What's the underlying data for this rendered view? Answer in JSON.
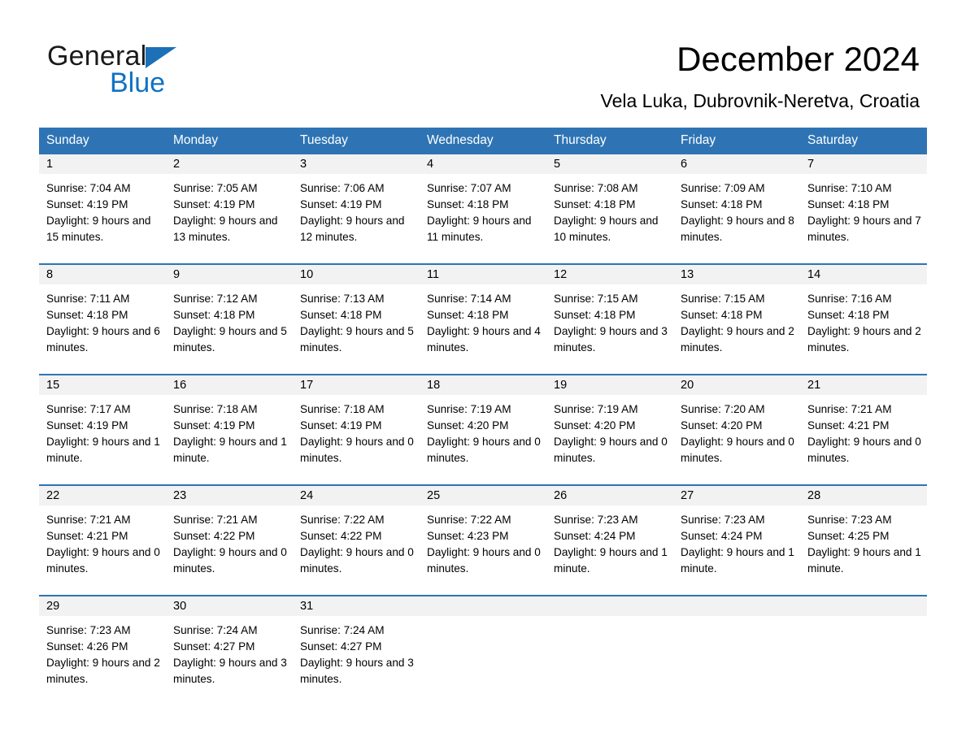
{
  "brand": {
    "name_part1": "General",
    "name_part2": "Blue",
    "triangle_color": "#1b70b8",
    "blue_text_color": "#0f72c4"
  },
  "header": {
    "title": "December 2024",
    "subtitle": "Vela Luka, Dubrovnik-Neretva, Croatia"
  },
  "theme": {
    "header_blue": "#2e74b5",
    "daystrip_gray": "#f2f2f2",
    "text_black": "#000000",
    "header_text_white": "#ffffff"
  },
  "weekdays": [
    "Sunday",
    "Monday",
    "Tuesday",
    "Wednesday",
    "Thursday",
    "Friday",
    "Saturday"
  ],
  "weeks": [
    {
      "days": [
        {
          "num": "1",
          "sunrise": "Sunrise: 7:04 AM",
          "sunset": "Sunset: 4:19 PM",
          "daylight": "Daylight: 9 hours and 15 minutes."
        },
        {
          "num": "2",
          "sunrise": "Sunrise: 7:05 AM",
          "sunset": "Sunset: 4:19 PM",
          "daylight": "Daylight: 9 hours and 13 minutes."
        },
        {
          "num": "3",
          "sunrise": "Sunrise: 7:06 AM",
          "sunset": "Sunset: 4:19 PM",
          "daylight": "Daylight: 9 hours and 12 minutes."
        },
        {
          "num": "4",
          "sunrise": "Sunrise: 7:07 AM",
          "sunset": "Sunset: 4:18 PM",
          "daylight": "Daylight: 9 hours and 11 minutes."
        },
        {
          "num": "5",
          "sunrise": "Sunrise: 7:08 AM",
          "sunset": "Sunset: 4:18 PM",
          "daylight": "Daylight: 9 hours and 10 minutes."
        },
        {
          "num": "6",
          "sunrise": "Sunrise: 7:09 AM",
          "sunset": "Sunset: 4:18 PM",
          "daylight": "Daylight: 9 hours and 8 minutes."
        },
        {
          "num": "7",
          "sunrise": "Sunrise: 7:10 AM",
          "sunset": "Sunset: 4:18 PM",
          "daylight": "Daylight: 9 hours and 7 minutes."
        }
      ]
    },
    {
      "days": [
        {
          "num": "8",
          "sunrise": "Sunrise: 7:11 AM",
          "sunset": "Sunset: 4:18 PM",
          "daylight": "Daylight: 9 hours and 6 minutes."
        },
        {
          "num": "9",
          "sunrise": "Sunrise: 7:12 AM",
          "sunset": "Sunset: 4:18 PM",
          "daylight": "Daylight: 9 hours and 5 minutes."
        },
        {
          "num": "10",
          "sunrise": "Sunrise: 7:13 AM",
          "sunset": "Sunset: 4:18 PM",
          "daylight": "Daylight: 9 hours and 5 minutes."
        },
        {
          "num": "11",
          "sunrise": "Sunrise: 7:14 AM",
          "sunset": "Sunset: 4:18 PM",
          "daylight": "Daylight: 9 hours and 4 minutes."
        },
        {
          "num": "12",
          "sunrise": "Sunrise: 7:15 AM",
          "sunset": "Sunset: 4:18 PM",
          "daylight": "Daylight: 9 hours and 3 minutes."
        },
        {
          "num": "13",
          "sunrise": "Sunrise: 7:15 AM",
          "sunset": "Sunset: 4:18 PM",
          "daylight": "Daylight: 9 hours and 2 minutes."
        },
        {
          "num": "14",
          "sunrise": "Sunrise: 7:16 AM",
          "sunset": "Sunset: 4:18 PM",
          "daylight": "Daylight: 9 hours and 2 minutes."
        }
      ]
    },
    {
      "days": [
        {
          "num": "15",
          "sunrise": "Sunrise: 7:17 AM",
          "sunset": "Sunset: 4:19 PM",
          "daylight": "Daylight: 9 hours and 1 minute."
        },
        {
          "num": "16",
          "sunrise": "Sunrise: 7:18 AM",
          "sunset": "Sunset: 4:19 PM",
          "daylight": "Daylight: 9 hours and 1 minute."
        },
        {
          "num": "17",
          "sunrise": "Sunrise: 7:18 AM",
          "sunset": "Sunset: 4:19 PM",
          "daylight": "Daylight: 9 hours and 0 minutes."
        },
        {
          "num": "18",
          "sunrise": "Sunrise: 7:19 AM",
          "sunset": "Sunset: 4:20 PM",
          "daylight": "Daylight: 9 hours and 0 minutes."
        },
        {
          "num": "19",
          "sunrise": "Sunrise: 7:19 AM",
          "sunset": "Sunset: 4:20 PM",
          "daylight": "Daylight: 9 hours and 0 minutes."
        },
        {
          "num": "20",
          "sunrise": "Sunrise: 7:20 AM",
          "sunset": "Sunset: 4:20 PM",
          "daylight": "Daylight: 9 hours and 0 minutes."
        },
        {
          "num": "21",
          "sunrise": "Sunrise: 7:21 AM",
          "sunset": "Sunset: 4:21 PM",
          "daylight": "Daylight: 9 hours and 0 minutes."
        }
      ]
    },
    {
      "days": [
        {
          "num": "22",
          "sunrise": "Sunrise: 7:21 AM",
          "sunset": "Sunset: 4:21 PM",
          "daylight": "Daylight: 9 hours and 0 minutes."
        },
        {
          "num": "23",
          "sunrise": "Sunrise: 7:21 AM",
          "sunset": "Sunset: 4:22 PM",
          "daylight": "Daylight: 9 hours and 0 minutes."
        },
        {
          "num": "24",
          "sunrise": "Sunrise: 7:22 AM",
          "sunset": "Sunset: 4:22 PM",
          "daylight": "Daylight: 9 hours and 0 minutes."
        },
        {
          "num": "25",
          "sunrise": "Sunrise: 7:22 AM",
          "sunset": "Sunset: 4:23 PM",
          "daylight": "Daylight: 9 hours and 0 minutes."
        },
        {
          "num": "26",
          "sunrise": "Sunrise: 7:23 AM",
          "sunset": "Sunset: 4:24 PM",
          "daylight": "Daylight: 9 hours and 1 minute."
        },
        {
          "num": "27",
          "sunrise": "Sunrise: 7:23 AM",
          "sunset": "Sunset: 4:24 PM",
          "daylight": "Daylight: 9 hours and 1 minute."
        },
        {
          "num": "28",
          "sunrise": "Sunrise: 7:23 AM",
          "sunset": "Sunset: 4:25 PM",
          "daylight": "Daylight: 9 hours and 1 minute."
        }
      ]
    },
    {
      "days": [
        {
          "num": "29",
          "sunrise": "Sunrise: 7:23 AM",
          "sunset": "Sunset: 4:26 PM",
          "daylight": "Daylight: 9 hours and 2 minutes."
        },
        {
          "num": "30",
          "sunrise": "Sunrise: 7:24 AM",
          "sunset": "Sunset: 4:27 PM",
          "daylight": "Daylight: 9 hours and 3 minutes."
        },
        {
          "num": "31",
          "sunrise": "Sunrise: 7:24 AM",
          "sunset": "Sunset: 4:27 PM",
          "daylight": "Daylight: 9 hours and 3 minutes."
        },
        {
          "num": "",
          "sunrise": "",
          "sunset": "",
          "daylight": ""
        },
        {
          "num": "",
          "sunrise": "",
          "sunset": "",
          "daylight": ""
        },
        {
          "num": "",
          "sunrise": "",
          "sunset": "",
          "daylight": ""
        },
        {
          "num": "",
          "sunrise": "",
          "sunset": "",
          "daylight": ""
        }
      ]
    }
  ]
}
